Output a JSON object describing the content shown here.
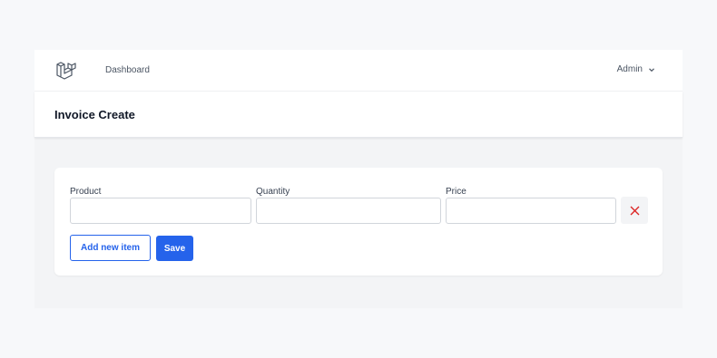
{
  "nav": {
    "logo_icon": "laravel-logo-icon",
    "links": [
      {
        "label": "Dashboard"
      }
    ],
    "user": {
      "label": "Admin",
      "icon": "chevron-down-icon"
    }
  },
  "header": {
    "title": "Invoice Create"
  },
  "form": {
    "fields": [
      {
        "label": "Product",
        "value": "",
        "placeholder": ""
      },
      {
        "label": "Quantity",
        "value": "",
        "placeholder": ""
      },
      {
        "label": "Price",
        "value": "",
        "placeholder": ""
      }
    ],
    "remove_icon": "close-icon",
    "add_label": "Add new item",
    "save_label": "Save"
  },
  "colors": {
    "accent": "#2563eb",
    "danger": "#dc2626",
    "page_bg": "#f3f4f6"
  }
}
